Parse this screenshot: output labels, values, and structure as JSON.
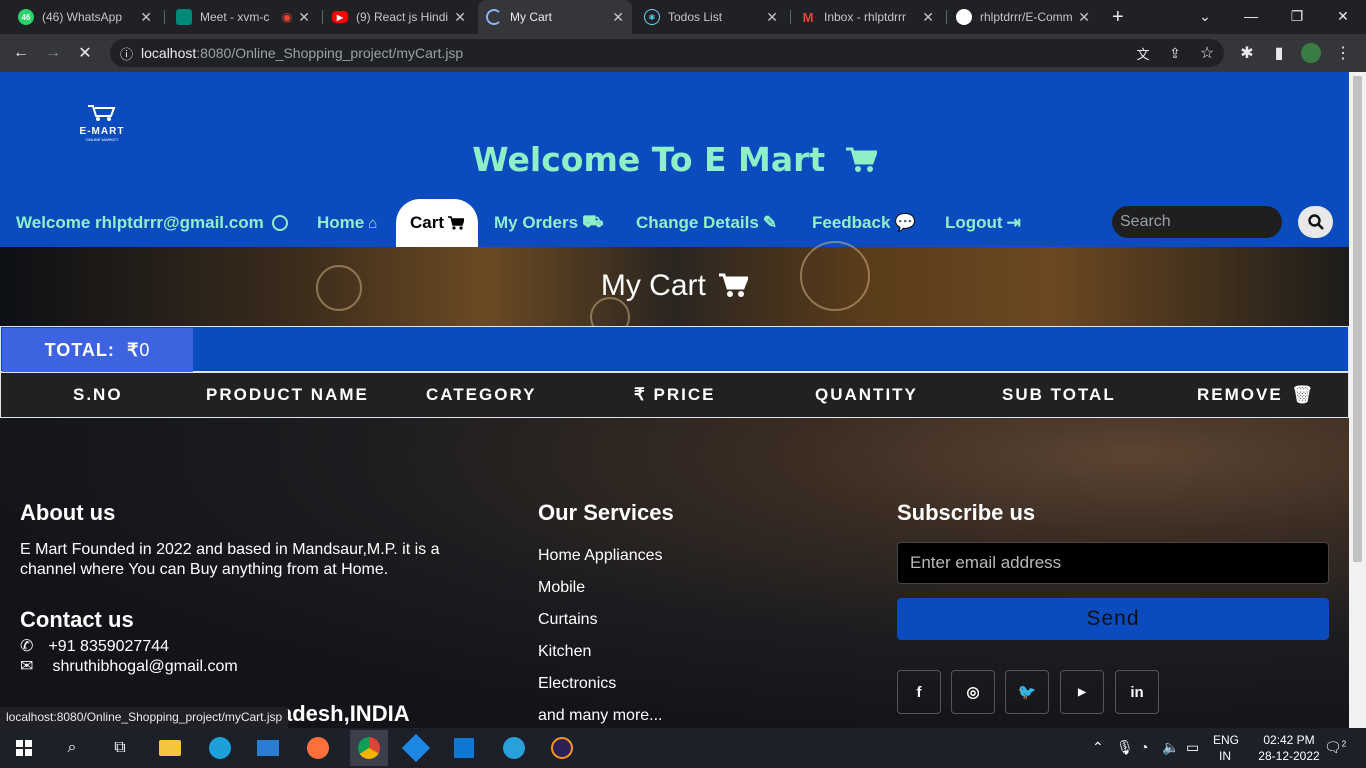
{
  "browser": {
    "tabs": [
      {
        "title": "(46) WhatsApp",
        "badge": "46",
        "icon": "whatsapp-icon",
        "color": "#25d366"
      },
      {
        "title": "Meet - xvm-c",
        "icon": "google-meet-icon",
        "color": "#00897b"
      },
      {
        "title": "(9) React js Hindi",
        "icon": "youtube-icon",
        "color": "#ff0000"
      },
      {
        "title": "My Cart",
        "icon": "loading-spinner-icon",
        "color": "#8ab4f8",
        "active": true
      },
      {
        "title": "Todos List",
        "icon": "react-icon",
        "color": "#61dafb"
      },
      {
        "title": "Inbox - rhlptdrrr",
        "icon": "gmail-icon",
        "color": "#ea4335"
      },
      {
        "title": "rhlptdrrr/E-Comm",
        "icon": "github-icon",
        "color": "#ffffff"
      }
    ],
    "new_tab": "+",
    "url_host": "localhost",
    "url_rest": ":8080/Online_Shopping_project/myCart.jsp",
    "status_url": "localhost:8080/Online_Shopping_project/myCart.jsp"
  },
  "site": {
    "logo_text": "E-MART",
    "logo_sub": "ONLINE MARKET",
    "welcome_title": "Welcome To E Mart",
    "nav": {
      "welcome_user": "Welcome rhlptdrrr@gmail.com",
      "home": "Home",
      "cart": "Cart",
      "orders": "My Orders",
      "change_details": "Change Details",
      "feedback": "Feedback",
      "logout": "Logout"
    },
    "search_placeholder": "Search",
    "page_heading": "My Cart",
    "total_label": "TOTAL: ",
    "total_currency": "₹",
    "total_value": "0",
    "table_headers": [
      "S.NO",
      "PRODUCT NAME",
      "CATEGORY",
      "₹ PRICE",
      "QUANTITY",
      "SUB TOTAL",
      "REMOVE"
    ],
    "footer": {
      "about_title": "About us",
      "about_text": "E Mart Founded in 2022 and based in Mandsaur,M.P. it is a channel where You can Buy anything from at Home.",
      "contact_title": "Contact us",
      "phone": "+91 8359027744",
      "email": "shruthibhogal@gmail.com",
      "address_partial": "adesh,INDIA",
      "services_title": "Our Services",
      "services": [
        "Home Appliances",
        "Mobile",
        "Curtains",
        "Kitchen",
        "Electronics",
        "and many more..."
      ],
      "subscribe_title": "Subscribe us",
      "email_placeholder": "Enter email address",
      "send_label": "Send",
      "social": [
        "facebook-icon",
        "instagram-icon",
        "twitter-icon",
        "youtube-icon",
        "linkedin-icon"
      ]
    }
  },
  "taskbar": {
    "lang": "ENG",
    "region": "IN",
    "time": "02:42 PM",
    "date": "28-12-2022",
    "notifications": "2"
  },
  "colors": {
    "brand_blue": "#0a4bbd",
    "accent_mint": "#8ff0c8",
    "total_box": "#3d63e0"
  }
}
